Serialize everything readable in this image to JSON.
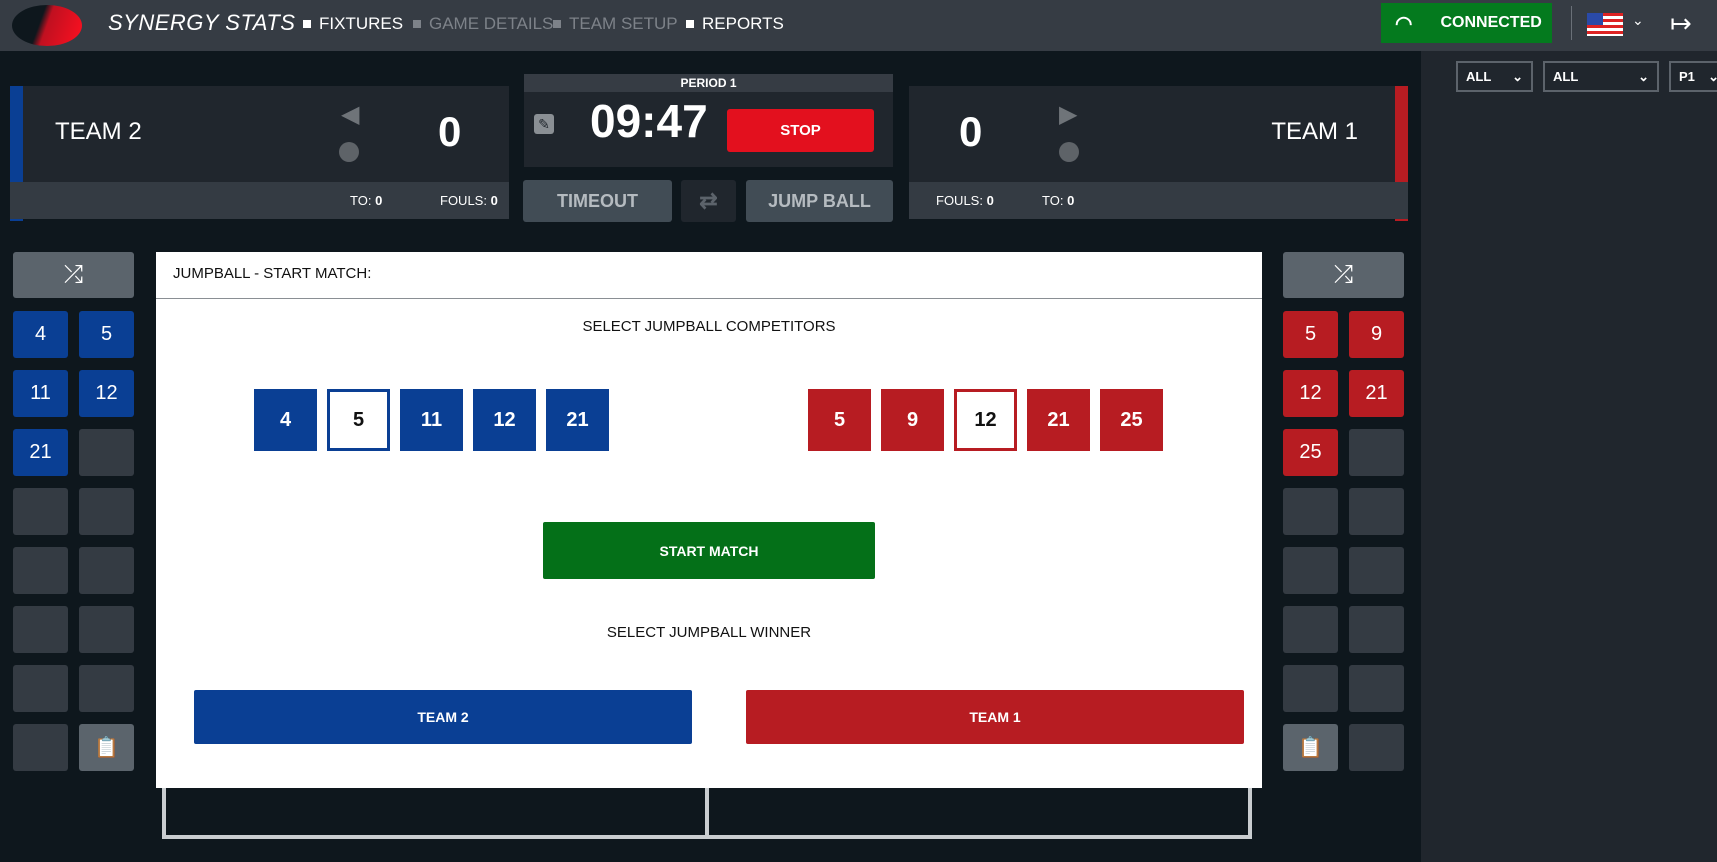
{
  "header": {
    "title": "SYNERGY STATS",
    "nav": [
      {
        "label": "FIXTURES",
        "enabled": true
      },
      {
        "label": "GAME DETAILS",
        "enabled": false
      },
      {
        "label": "TEAM SETUP",
        "enabled": false
      },
      {
        "label": "REPORTS",
        "enabled": true
      }
    ],
    "status": "CONNECTED",
    "status_color": "#047a1e"
  },
  "filters": [
    "ALL",
    "ALL",
    "P1"
  ],
  "team_left": {
    "name": "TEAM 2",
    "score": "0",
    "to_label": "TO:",
    "to": "0",
    "fouls_label": "FOULS:",
    "fouls": "0",
    "color": "#0a3f94"
  },
  "team_right": {
    "name": "TEAM 1",
    "score": "0",
    "to_label": "TO:",
    "to": "0",
    "fouls_label": "FOULS:",
    "fouls": "0",
    "color": "#b71c22"
  },
  "clock": {
    "period": "PERIOD 1",
    "time": "09:47",
    "stop": "STOP"
  },
  "buttons": {
    "timeout": "TIMEOUT",
    "jump_ball": "JUMP BALL"
  },
  "left_roster": [
    "4",
    "5",
    "11",
    "12",
    "21"
  ],
  "right_roster": [
    "5",
    "9",
    "12",
    "21",
    "25"
  ],
  "modal": {
    "title": "JUMPBALL - START MATCH:",
    "competitors_label": "SELECT JUMPBALL COMPETITORS",
    "left_players": [
      "4",
      "5",
      "11",
      "12",
      "21"
    ],
    "left_selected": "5",
    "right_players": [
      "5",
      "9",
      "12",
      "21",
      "25"
    ],
    "right_selected": "12",
    "start": "START MATCH",
    "winner_label": "SELECT JUMPBALL WINNER",
    "winner_left": "TEAM 2",
    "winner_right": "TEAM 1"
  }
}
